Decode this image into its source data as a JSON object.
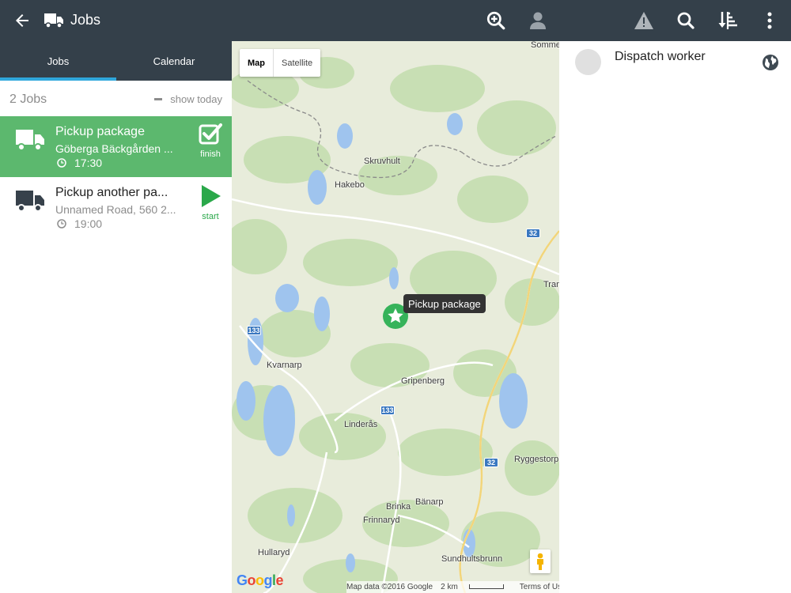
{
  "header": {
    "title": "Jobs",
    "icons": [
      "arrow-back-icon",
      "truck-icon",
      "zoom-in-icon",
      "person-icon",
      "warning-icon",
      "search-icon",
      "sort-icon",
      "more-vert-icon"
    ]
  },
  "tabs": [
    {
      "label": "Jobs",
      "active": true
    },
    {
      "label": "Calendar",
      "active": false
    }
  ],
  "list": {
    "count_label": "2 Jobs",
    "filter_label": "show today"
  },
  "jobs": [
    {
      "title": "Pickup package",
      "address": "Göberga Bäckgården ...",
      "time": "17:30",
      "action": "finish",
      "state": "active"
    },
    {
      "title": "Pickup another pa...",
      "address": "Unnamed Road, 560 2...",
      "time": "19:00",
      "action": "start",
      "state": "pending"
    }
  ],
  "map": {
    "type_options": [
      "Map",
      "Satellite"
    ],
    "selected_type": "Map",
    "marker_label": "Pickup package",
    "places": [
      "Somme",
      "Skruvhult",
      "Hakebo",
      "Tran",
      "Kvarnarp",
      "Gripenberg",
      "Linderås",
      "Ryggestorp",
      "Brinka",
      "Bänarp",
      "Frinnaryd",
      "Hullaryd",
      "Sundhultsbrunn"
    ],
    "road_shields": [
      "32",
      "133",
      "133",
      "32"
    ],
    "logo": "Google",
    "attribution": "Map data ©2016 Google",
    "scale": "2 km",
    "terms": "Terms of Use"
  },
  "worker": {
    "name": "Dispatch worker"
  },
  "colors": {
    "topbar": "#34404a",
    "accent": "#2fa7dc",
    "active_job": "#5cb86e",
    "start_green": "#2aa84a"
  }
}
